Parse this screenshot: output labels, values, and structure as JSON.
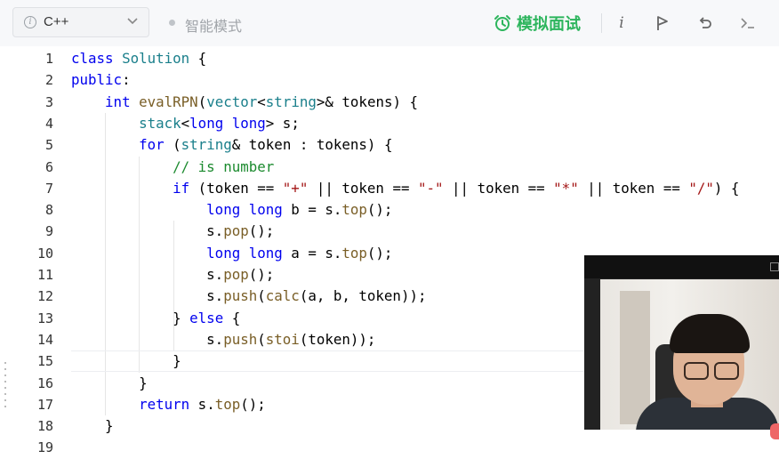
{
  "toolbar": {
    "language": "C++",
    "mode_label": "智能模式",
    "mock_label": "模拟面试",
    "icons": {
      "info": "info-icon",
      "language_dropdown": "chevron-down-icon",
      "mock": "alarm-clock-icon",
      "detail": "italic-i-icon",
      "flag": "flag-icon",
      "reset": "undo-icon",
      "console": "terminal-icon"
    },
    "accent_color": "#2db55d"
  },
  "editor": {
    "lines": [
      {
        "n": "1",
        "text": "class Solution {"
      },
      {
        "n": "2",
        "text": "public:"
      },
      {
        "n": "3",
        "text": "    int evalRPN(vector<string>& tokens) {"
      },
      {
        "n": "4",
        "text": "        stack<long long> s;"
      },
      {
        "n": "5",
        "text": "        for (string& token : tokens) {"
      },
      {
        "n": "6",
        "text": "            // is number"
      },
      {
        "n": "7",
        "text": "            if (token == \"+\" || token == \"-\" || token == \"*\" || token == \"/\") {"
      },
      {
        "n": "8",
        "text": "                long long b = s.top();"
      },
      {
        "n": "9",
        "text": "                s.pop();"
      },
      {
        "n": "10",
        "text": "                long long a = s.top();"
      },
      {
        "n": "11",
        "text": "                s.pop();"
      },
      {
        "n": "12",
        "text": "                s.push(calc(a, b, token));"
      },
      {
        "n": "13",
        "text": "            } else {"
      },
      {
        "n": "14",
        "text": "                s.push(stoi(token));"
      },
      {
        "n": "15",
        "text": "            }"
      },
      {
        "n": "16",
        "text": "        }"
      },
      {
        "n": "17",
        "text": "        return s.top();"
      },
      {
        "n": "18",
        "text": "    }"
      },
      {
        "n": "19",
        "text": ""
      }
    ],
    "active_line": "15"
  },
  "webcam": {
    "icon": "webcam-video-icon"
  }
}
